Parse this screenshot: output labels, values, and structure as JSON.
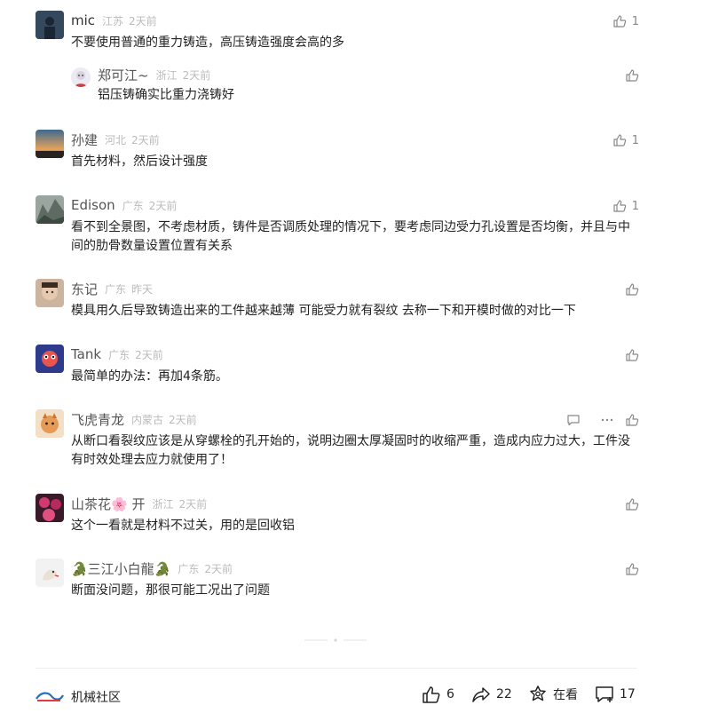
{
  "comments": [
    {
      "name": "mic",
      "location": "江苏",
      "time": "2天前",
      "text": "不要使用普通的重力铸造，高压铸造强度会高的多",
      "likes": "1"
    },
    {
      "name": "郑可江~",
      "location": "浙江",
      "time": "2天前",
      "text": "铝压铸确实比重力浇铸好",
      "likes": ""
    },
    {
      "name": "孙建",
      "location": "河北",
      "time": "2天前",
      "text": "首先材料，然后设计强度",
      "likes": "1"
    },
    {
      "name": "Edison",
      "location": "广东",
      "time": "2天前",
      "text": "看不到全景图，不考虑材质，铸件是否调质处理的情况下，要考虑同边受力孔设置是否均衡，并且与中间的肋骨数量设置位置有关系",
      "likes": "1"
    },
    {
      "name": "东记",
      "location": "广东",
      "time": "昨天",
      "text": "模具用久后导致铸造出来的工件越来越薄  可能受力就有裂纹 去称一下和开模时做的对比一下",
      "likes": ""
    },
    {
      "name": "Tank",
      "location": "广东",
      "time": "2天前",
      "text": "最简单的办法：再加4条筋。",
      "likes": ""
    },
    {
      "name": "飞虎青龙",
      "location": "内蒙古",
      "time": "2天前",
      "text": "从断口看裂纹应该是从穿螺栓的孔开始的，说明边圈太厚凝固时的收缩严重，造成内应力过大，工件没有时效处理去应力就使用了！",
      "likes": ""
    },
    {
      "name": "山茶花🌸 开",
      "location": "浙江",
      "time": "2天前",
      "text": "这个一看就是材料不过关，用的是回收铝",
      "likes": ""
    },
    {
      "name": "🐊三江小白龍🐊",
      "location": "广东",
      "time": "2天前",
      "text": "断面没问题，那很可能工况出了问题",
      "likes": ""
    }
  ],
  "footer": {
    "brand": "机械社区",
    "likes": "6",
    "shares": "22",
    "watching": "在看",
    "comments": "17"
  },
  "colors": {
    "text": "#222222",
    "muted": "#bbbbbb",
    "name": "#555555",
    "icon": "#888888"
  }
}
